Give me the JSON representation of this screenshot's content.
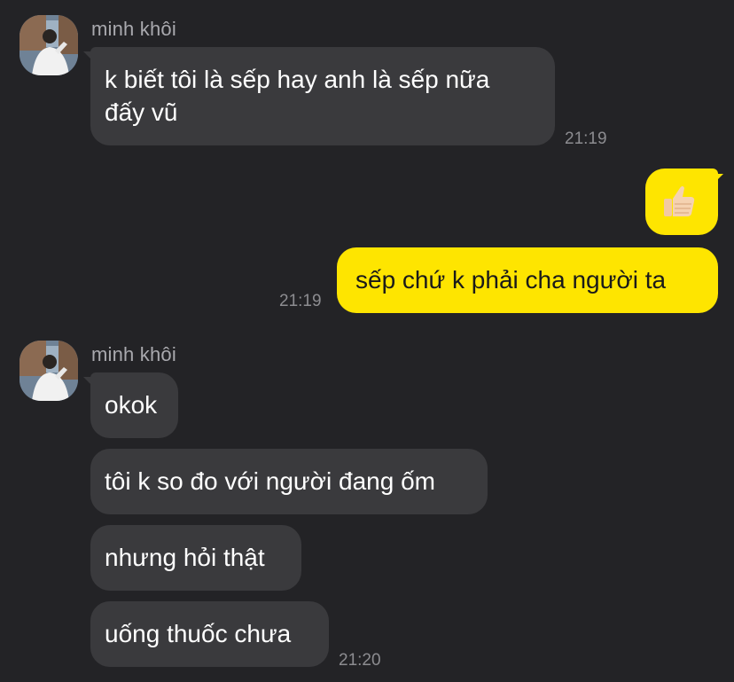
{
  "conversation": {
    "group1": {
      "sender": "minh khôi",
      "avatar_icon": "profile-photo",
      "message": "k biết tôi là sếp hay anh là sếp nữa đấy vũ",
      "message_line1": "k biết tôi là sếp hay anh là sếp nữa",
      "message_line2": "đấy vũ",
      "time": "21:19"
    },
    "sent": {
      "emoji": "👍🏻",
      "message": "sếp chứ k phải cha người ta",
      "time": "21:19"
    },
    "group2": {
      "sender": "minh khôi",
      "avatar_icon": "profile-photo",
      "messages": [
        "okok",
        "tôi k so đo với người đang ốm",
        "nhưng hỏi thật",
        "uống thuốc chưa"
      ],
      "time": "21:20"
    }
  },
  "colors": {
    "background": "#232326",
    "incoming_bubble": "#3a3a3d",
    "outgoing_bubble": "#fee500",
    "timestamp": "#8c8c90",
    "sender_name": "#a9a9ae"
  }
}
